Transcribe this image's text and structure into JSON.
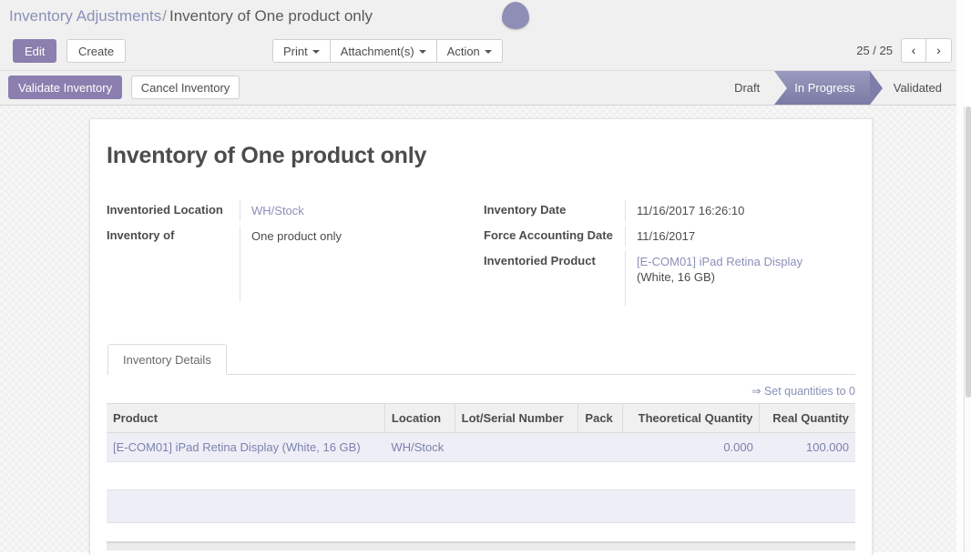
{
  "breadcrumb": {
    "parent": "Inventory Adjustments",
    "separator": "/",
    "current": "Inventory of One product only"
  },
  "control_panel": {
    "edit_label": "Edit",
    "create_label": "Create",
    "print_label": "Print",
    "attachments_label": "Attachment(s)",
    "action_label": "Action",
    "pager_counter": "25 / 25",
    "prev_icon": "‹",
    "next_icon": "›"
  },
  "status_bar": {
    "validate_label": "Validate Inventory",
    "cancel_label": "Cancel Inventory",
    "stages": [
      {
        "label": "Draft",
        "active": false
      },
      {
        "label": "In Progress",
        "active": true
      },
      {
        "label": "Validated",
        "active": false
      }
    ],
    "active_color": "#8a8ab0"
  },
  "form": {
    "title": "Inventory of One product only",
    "left_fields": [
      {
        "label": "Inventoried Location",
        "value": "WH/Stock",
        "is_link": true
      },
      {
        "label": "Inventory of",
        "value": "One product only",
        "is_link": false
      }
    ],
    "right_fields": [
      {
        "label": "Inventory Date",
        "value": "11/16/2017 16:26:10",
        "is_link": false
      },
      {
        "label": "Force Accounting Date",
        "value": "11/16/2017",
        "is_link": false
      },
      {
        "label": "Inventoried Product",
        "value": "[E-COM01] iPad Retina Display",
        "value_suffix": "(White, 16 GB)",
        "is_link": true
      }
    ]
  },
  "notebook": {
    "tabs": [
      {
        "label": "Inventory Details",
        "active": true
      }
    ],
    "set_quantities_label": "⇒ Set quantities to 0",
    "table": {
      "columns": [
        {
          "label": "Product",
          "align": "left"
        },
        {
          "label": "Location",
          "align": "left"
        },
        {
          "label": "Lot/Serial Number",
          "align": "left"
        },
        {
          "label": "Pack",
          "align": "left"
        },
        {
          "label": "Theoretical Quantity",
          "align": "right"
        },
        {
          "label": "Real Quantity",
          "align": "right"
        }
      ],
      "rows": [
        {
          "product": "[E-COM01] iPad Retina Display (White, 16 GB)",
          "location": "WH/Stock",
          "lot_serial": "",
          "pack": "",
          "theoretical_quantity": "0.000",
          "real_quantity": "100.000"
        }
      ],
      "empty_row": {
        "product": "",
        "location": "",
        "lot_serial": "",
        "pack": "",
        "theoretical_quantity": "",
        "real_quantity": ""
      }
    }
  }
}
